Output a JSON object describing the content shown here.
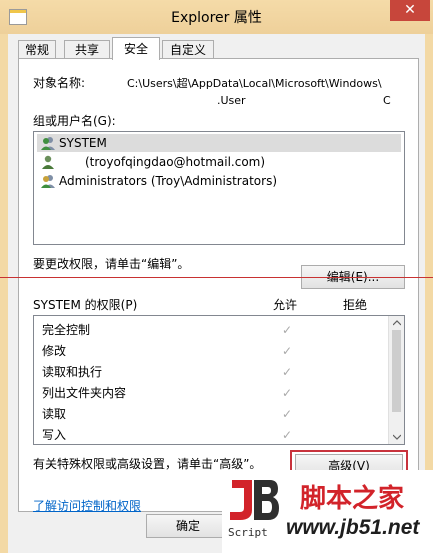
{
  "window": {
    "title": "Explorer 属性",
    "close_glyph": "✕"
  },
  "tabs": [
    {
      "label": "常规"
    },
    {
      "label": "共享"
    },
    {
      "label": "安全"
    },
    {
      "label": "自定义"
    }
  ],
  "security": {
    "object_name_label": "对象名称:",
    "object_path_line1": "C:\\Users\\超\\AppData\\Local\\Microsoft\\Windows\\",
    "object_path_line2": ".User",
    "object_path_line2_tail": "C",
    "groups_label": "组或用户名(G):",
    "users": [
      {
        "name": "SYSTEM",
        "icon": "user-group-icon"
      },
      {
        "name": "(troyofqingdao@hotmail.com)",
        "icon": "user-icon"
      },
      {
        "name": "Administrators (Troy\\Administrators)",
        "icon": "user-group-icon"
      }
    ],
    "change_hint": "要更改权限，请单击“编辑”。",
    "edit_button": "编辑(E)...",
    "permissions_label": "SYSTEM 的权限(P)",
    "allow_header": "允许",
    "deny_header": "拒绝",
    "permissions": [
      {
        "name": "完全控制",
        "allow": "✓"
      },
      {
        "name": "修改",
        "allow": "✓"
      },
      {
        "name": "读取和执行",
        "allow": "✓"
      },
      {
        "name": "列出文件夹内容",
        "allow": "✓"
      },
      {
        "name": "读取",
        "allow": "✓"
      },
      {
        "name": "写入",
        "allow": "✓"
      }
    ],
    "advanced_hint": "有关特殊权限或高级设置，请单击“高级”。",
    "advanced_button": "高级(V)",
    "learn_link": "了解访问控制和权限"
  },
  "footer": {
    "ok_button": "确定"
  },
  "watermark": {
    "logo_letters": "JB",
    "logo_sub": "Script",
    "site_cn": "脚本之家",
    "site_url": "www.jb51.net"
  },
  "colors": {
    "title_bar": "#f3d9a5",
    "close_button": "#c7463b",
    "highlight_border": "#c8323c",
    "watermark_red": "#d2232a"
  }
}
